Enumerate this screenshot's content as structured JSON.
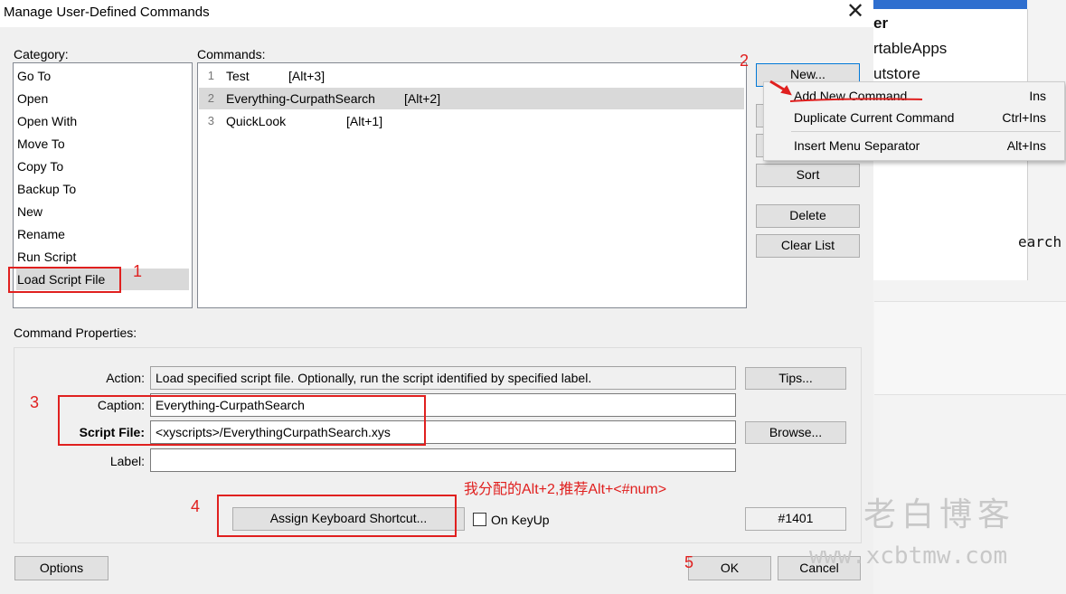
{
  "window": {
    "title": "Manage User-Defined Commands",
    "close_glyph": "✕"
  },
  "category": {
    "label": "Category:",
    "items": [
      "Go To",
      "Open",
      "Open With",
      "Move To",
      "Copy To",
      "Backup To",
      "New",
      "Rename",
      "Run Script",
      "Load Script File"
    ],
    "selected_index": 9
  },
  "commands": {
    "label": "Commands:",
    "rows": [
      {
        "num": "1",
        "name": "Test",
        "key": "[Alt+3]"
      },
      {
        "num": "2",
        "name": "Everything-CurpathSearch",
        "key": "[Alt+2]"
      },
      {
        "num": "3",
        "name": "QuickLook",
        "key": "[Alt+1]"
      }
    ],
    "selected_index": 1
  },
  "buttons": {
    "new": "New...",
    "sort": "Sort",
    "delete": "Delete",
    "clear_list": "Clear List",
    "tips": "Tips...",
    "browse": "Browse...",
    "assign_shortcut": "Assign Keyboard Shortcut...",
    "options": "Options",
    "ok": "OK",
    "cancel": "Cancel"
  },
  "context_menu": {
    "items": [
      {
        "label": "Add New Command",
        "shortcut": "Ins"
      },
      {
        "label": "Duplicate Current Command",
        "shortcut": "Ctrl+Ins"
      },
      {
        "label": "Insert Menu Separator",
        "shortcut": "Alt+Ins"
      }
    ]
  },
  "properties": {
    "section_label": "Command Properties:",
    "action_label": "Action:",
    "action_value": "Load specified script file. Optionally, run the script identified by specified label.",
    "caption_label": "Caption:",
    "caption_value": "Everything-CurpathSearch",
    "script_file_label": "Script File:",
    "script_file_value": "<xyscripts>/EverythingCurpathSearch.xys",
    "label_label": "Label:",
    "label_value": "",
    "on_keyup_label": "On KeyUp",
    "command_id": "#1401"
  },
  "annotations": {
    "n1": "1",
    "n2": "2",
    "n3": "3",
    "n4": "4",
    "n5": "5",
    "note": "我分配的Alt+2,推荐Alt+<#num>",
    "color": "#e0201f"
  },
  "watermark": {
    "line1": "老白博客",
    "line2": "www.xcbtmw.com"
  },
  "background_app": {
    "t1": "er",
    "t2": "rtableApps",
    "t3": "utstore",
    "t4": "earch"
  }
}
